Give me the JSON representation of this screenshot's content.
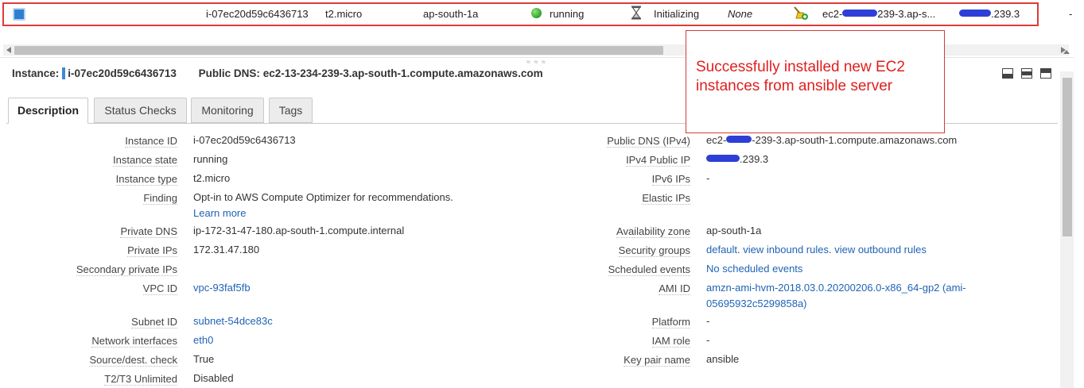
{
  "instance_row": {
    "instance_id": "i-07ec20d59c6436713",
    "instance_type": "t2.micro",
    "availability_zone": "ap-south-1a",
    "state": "running",
    "status_checks": "Initializing",
    "alarm_status": "None",
    "public_dns_prefix": "ec2-",
    "public_dns_suffix": "239-3.ap-s...",
    "public_ip_suffix": ".239.3",
    "trailing": "-"
  },
  "header": {
    "instance_label": "Instance:",
    "instance_id": "i-07ec20d59c6436713",
    "public_dns_label": "Public DNS:",
    "public_dns": "ec2-13-234-239-3.ap-south-1.compute.amazonaws.com"
  },
  "annotation": {
    "text": "Successfully installed new EC2 instances from ansible server"
  },
  "splitter": {
    "grip": "≈ ≈ ≈"
  },
  "tabs": [
    {
      "label": "Description"
    },
    {
      "label": "Status Checks"
    },
    {
      "label": "Monitoring"
    },
    {
      "label": "Tags"
    }
  ],
  "details_left": {
    "instance_id": {
      "label": "Instance ID",
      "value": "i-07ec20d59c6436713"
    },
    "instance_state": {
      "label": "Instance state",
      "value": "running"
    },
    "instance_type": {
      "label": "Instance type",
      "value": "t2.micro"
    },
    "finding": {
      "label": "Finding",
      "value": "Opt-in to AWS Compute Optimizer for recommendations.",
      "link": "Learn more"
    },
    "private_dns": {
      "label": "Private DNS",
      "value": "ip-172-31-47-180.ap-south-1.compute.internal"
    },
    "private_ips": {
      "label": "Private IPs",
      "value": "172.31.47.180"
    },
    "secondary_private_ips": {
      "label": "Secondary private IPs",
      "value": ""
    },
    "vpc_id": {
      "label": "VPC ID",
      "value": "vpc-93faf5fb"
    },
    "subnet_id": {
      "label": "Subnet ID",
      "value": "subnet-54dce83c"
    },
    "network_interfaces": {
      "label": "Network interfaces",
      "value": "eth0"
    },
    "source_dest_check": {
      "label": "Source/dest. check",
      "value": "True"
    },
    "t2t3_unlimited": {
      "label": "T2/T3 Unlimited",
      "value": "Disabled"
    }
  },
  "details_right": {
    "public_dns": {
      "label": "Public DNS (IPv4)",
      "value_prefix": "ec2-",
      "value_suffix": "-239-3.ap-south-1.compute.amazonaws.com"
    },
    "ipv4_public_ip": {
      "label": "IPv4 Public IP",
      "value_suffix": ".239.3"
    },
    "ipv6_ips": {
      "label": "IPv6 IPs",
      "value": "-"
    },
    "elastic_ips": {
      "label": "Elastic IPs",
      "value": ""
    },
    "availability_zone": {
      "label": "Availability zone",
      "value": "ap-south-1a"
    },
    "security_groups": {
      "label": "Security groups",
      "link1": "default",
      "link2": "view inbound rules",
      "link3": "view outbound rules"
    },
    "scheduled_events": {
      "label": "Scheduled events",
      "value": "No scheduled events"
    },
    "ami_id": {
      "label": "AMI ID",
      "value_line1": "amzn-ami-hvm-2018.03.0.20200206.0-x86_64-gp2 (ami-",
      "value_line2": "05695932c5299858a)"
    },
    "platform": {
      "label": "Platform",
      "value": "-"
    },
    "iam_role": {
      "label": "IAM role",
      "value": "-"
    },
    "key_pair_name": {
      "label": "Key pair name",
      "value": "ansible"
    }
  },
  "colors": {
    "highlight_border": "#e03a3a",
    "annotation_text": "#e01e1e",
    "link": "#1f63b5",
    "running_dot": "#2fa12a",
    "redaction": "#2d3fd6"
  },
  "icons": {
    "row_select": "checkbox-selected",
    "state": "green-dot-icon",
    "status": "hourglass-icon",
    "alarm": "broom-icon",
    "layout": [
      "layout-bottom-icon",
      "layout-middle-icon",
      "layout-top-icon"
    ]
  }
}
